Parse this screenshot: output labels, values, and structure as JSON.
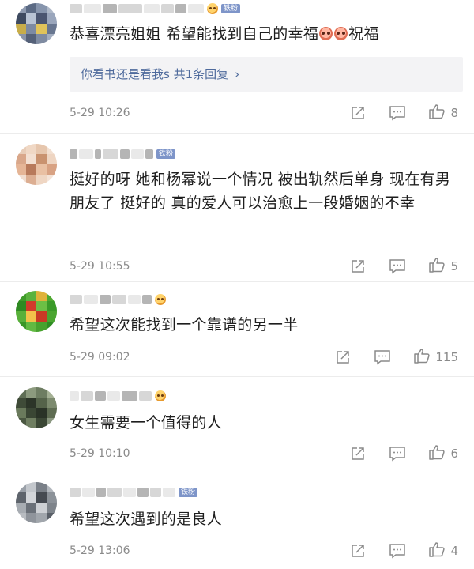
{
  "comments": [
    {
      "text_before_emoji": "恭喜漂亮姐姐  希望能找到自己的幸福",
      "text_after_emoji": "祝福",
      "inline_emojis": [
        "face-emoji",
        "face-emoji"
      ],
      "name_emoji": "grin-emoji",
      "badge": "铁粉",
      "reply_text": "你看书还是看我s  共1条回复",
      "reply_chevron": "›",
      "time": "5-29 10:26",
      "likes": "8"
    },
    {
      "text": "挺好的呀 她和杨幂说一个情况 被出轨然后单身 现在有男朋友了 挺好的 真的爱人可以治愈上一段婚姻的不幸",
      "badge": "铁粉",
      "time": "5-29 10:55",
      "likes": "5"
    },
    {
      "text": "希望这次能找到一个靠谱的另一半",
      "name_emoji": "grin-emoji",
      "time": "5-29 09:02",
      "likes": "115"
    },
    {
      "text": "女生需要一个值得的人",
      "name_emoji": "grin-emoji",
      "time": "5-29 10:10",
      "likes": "6"
    },
    {
      "text": "希望这次遇到的是良人",
      "badge": "铁粉",
      "time": "5-29 13:06",
      "likes": "4"
    }
  ],
  "icons": {
    "share": "share-icon",
    "comment": "comment-icon",
    "like": "thumbs-up-icon"
  },
  "colors": {
    "link": "#4e6a9c",
    "badge": "#7e95c9",
    "meta": "#8a8a8a"
  }
}
